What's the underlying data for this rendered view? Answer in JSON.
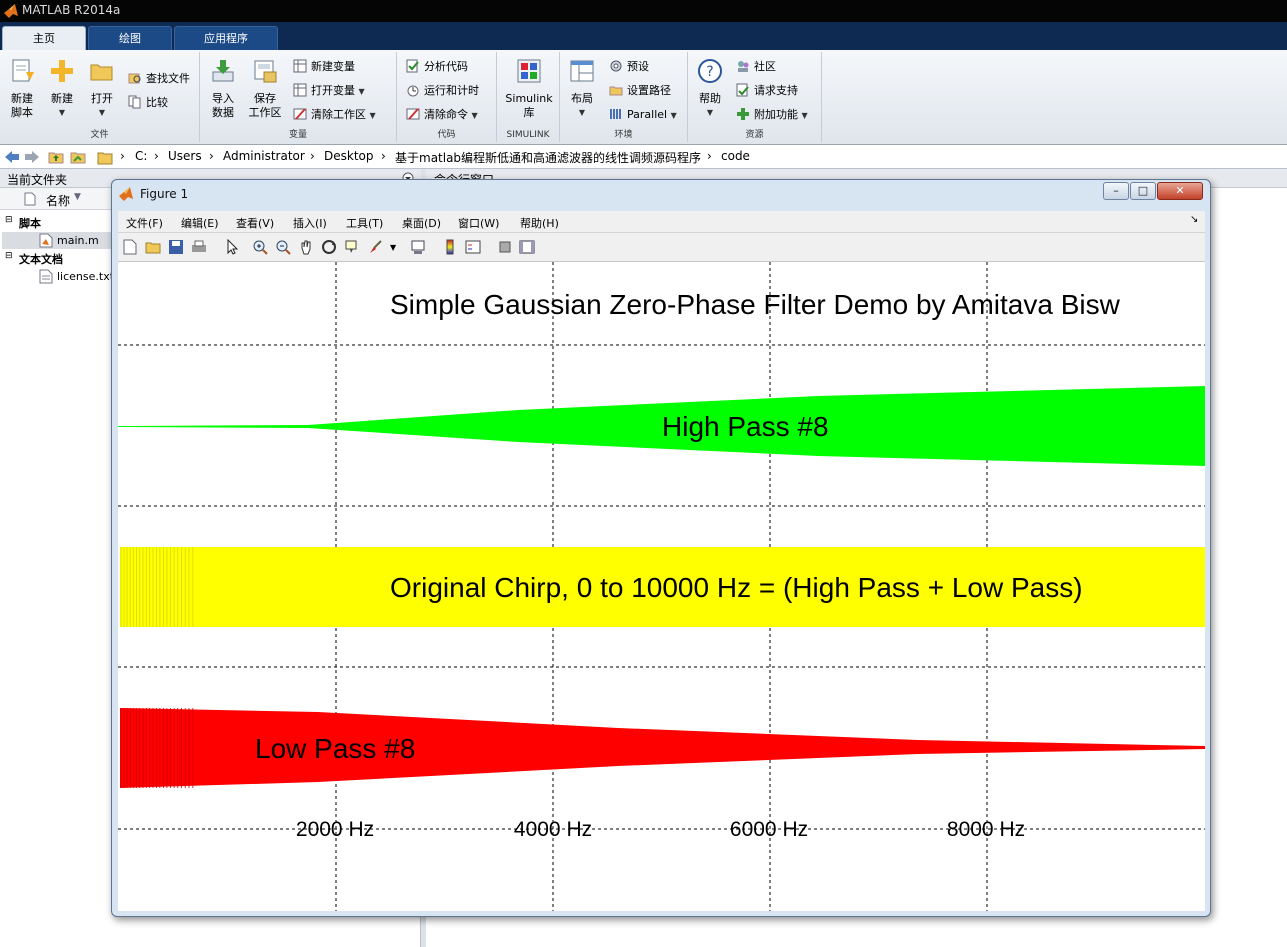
{
  "app": {
    "title": "MATLAB R2014a"
  },
  "tabs": [
    {
      "label": "主页",
      "active": true
    },
    {
      "label": "绘图",
      "active": false
    },
    {
      "label": "应用程序",
      "active": false
    }
  ],
  "ribbon": {
    "file": {
      "label": "文件",
      "new_script_l1": "新建",
      "new_script_l2": "脚本",
      "new": "新建",
      "open": "打开",
      "find_files": "查找文件",
      "compare": "比较"
    },
    "variable": {
      "label": "变量",
      "import_l1": "导入",
      "import_l2": "数据",
      "save_l1": "保存",
      "save_l2": "工作区",
      "new_var": "新建变量",
      "open_var": "打开变量",
      "clear_ws": "清除工作区"
    },
    "code": {
      "label": "代码",
      "analyze": "分析代码",
      "run_time": "运行和计时",
      "clear_cmd": "清除命令"
    },
    "simulink": {
      "label": "SIMULINK",
      "lib_l1": "Simulink",
      "lib_l2": "库"
    },
    "env": {
      "label": "环境",
      "layout": "布局",
      "prefs": "预设",
      "set_path": "设置路径",
      "parallel": "Parallel"
    },
    "resources": {
      "label": "资源",
      "help": "帮助",
      "community": "社区",
      "support": "请求支持",
      "addons": "附加功能"
    }
  },
  "address": {
    "path": [
      "C:",
      "Users",
      "Administrator",
      "Desktop",
      "基于matlab编程斯低通和高通滤波器的线性调频源码程序",
      "code"
    ]
  },
  "file_browser": {
    "title": "当前文件夹",
    "col_name": "名称",
    "groups": [
      {
        "label": "脚本",
        "items": [
          "main.m"
        ]
      },
      {
        "label": "文本文档",
        "items": [
          "license.txt"
        ]
      }
    ]
  },
  "command_window": {
    "title": "命令行窗口"
  },
  "figure": {
    "title": "Figure 1",
    "menu": [
      "文件(F)",
      "编辑(E)",
      "查看(V)",
      "插入(I)",
      "工具(T)",
      "桌面(D)",
      "窗口(W)",
      "帮助(H)"
    ],
    "plot_title": "Simple Gaussian Zero-Phase Filter Demo by Amitava Bisw",
    "bands": [
      {
        "label": "High Pass #8",
        "color": "#00ff00"
      },
      {
        "label": "Original Chirp, 0 to 10000 Hz = (High Pass + Low Pass)",
        "color": "#ffff00"
      },
      {
        "label": "Low Pass #8",
        "color": "#ff0000"
      }
    ],
    "freq_labels": [
      "2000 Hz",
      "4000 Hz",
      "6000 Hz",
      "8000 Hz"
    ]
  }
}
